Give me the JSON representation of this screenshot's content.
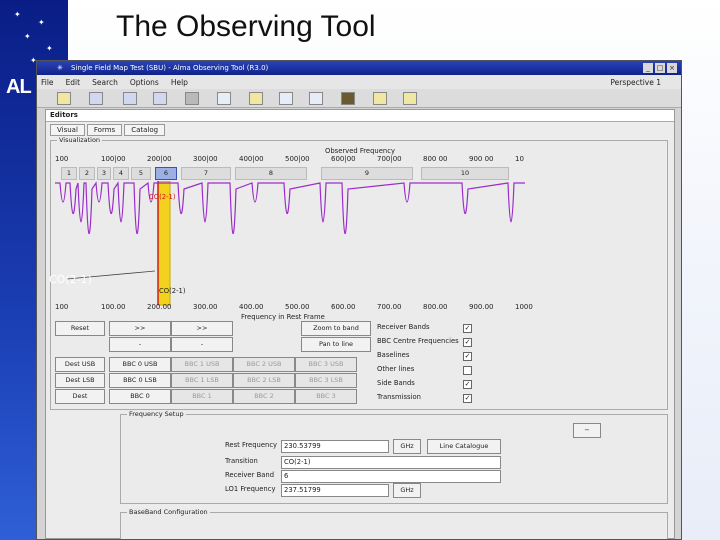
{
  "slide": {
    "title": "The Observing Tool",
    "logo": "AL"
  },
  "window": {
    "title": "Single Field Map Test (SBU) - Alma Observing Tool (R3.0)",
    "controls": [
      "_",
      "□",
      "×"
    ]
  },
  "menu": {
    "items": [
      "File",
      "Edit",
      "Search",
      "Options",
      "Help"
    ],
    "perspective": "Perspective 1"
  },
  "editors": {
    "header": "Editors",
    "tabs": [
      "Visual",
      "Forms",
      "Catalog"
    ]
  },
  "visualization": {
    "group_label": "Visualization",
    "top_axis_label": "Observed Frequency",
    "top_ticks": [
      "100",
      "100|00",
      "200|00",
      "300|00",
      "400|00",
      "500|00",
      "600|00",
      "700|00",
      "800 00",
      "900 00",
      "10"
    ],
    "bottom_ticks": [
      "100",
      "100.00",
      "200.00",
      "300.00",
      "400.00",
      "500.00",
      "600.00",
      "700.00",
      "800.00",
      "900.00",
      "1000"
    ],
    "bottom_axis_label": "Frequency in Rest Frame",
    "band_numbers": [
      "1",
      "2",
      "3",
      "4",
      "5",
      "6",
      "7",
      "8",
      "9",
      "10"
    ],
    "annotation_line": "CO(2-1)",
    "marker_top": "CO(2-1)",
    "marker_bottom": "CO(2-1)",
    "big_label": "CO(2-1)"
  },
  "controls": {
    "reset": "Reset",
    "arrows_up": [
      ">>",
      ">>"
    ],
    "arrows_down": [
      "-",
      "-"
    ],
    "zoom_to_band": "Zoom to band",
    "pan_to_line": "Pan to line",
    "rows": [
      {
        "left": "Dest USB",
        "cells": [
          "BBC 0 USB",
          "BBC 1 USB",
          "BBC 2 USB",
          "BBC 3 USB"
        ]
      },
      {
        "left": "Dest LSB",
        "cells": [
          "BBC 0 LSB",
          "BBC 1 LSB",
          "BBC 2 LSB",
          "BBC 3 LSB"
        ]
      },
      {
        "left": "Dest",
        "cells": [
          "BBC 0",
          "BBC 1",
          "BBC 2",
          "BBC 3"
        ]
      }
    ],
    "options": [
      {
        "label": "Receiver Bands",
        "checked": true
      },
      {
        "label": "BBC Centre Frequencies",
        "checked": true
      },
      {
        "label": "Baselines",
        "checked": true
      },
      {
        "label": "Other lines",
        "checked": false
      },
      {
        "label": "Side Bands",
        "checked": true
      },
      {
        "label": "Transmission",
        "checked": true
      }
    ]
  },
  "frequency_setup": {
    "group_label": "Frequency Setup",
    "rest_frequency_label": "Rest Frequency",
    "rest_frequency_value": "230.53799",
    "rest_unit": "GHz",
    "line_catalogue": "Line Catalogue",
    "transition_label": "Transition",
    "transition_value": "CO(2-1)",
    "receiver_band_label": "Receiver Band",
    "receiver_band_value": "6",
    "lo1_label": "LO1 Frequency",
    "lo1_value": "237.51799",
    "lo1_unit": "GHz",
    "minus_button": "−"
  },
  "baseband": {
    "group_label": "BaseBand Configuration"
  },
  "colors": {
    "accent": "#10238a",
    "band_highlight": "#f2d21e",
    "curve": "#9b2cc9",
    "marker": "#d21b1b"
  }
}
